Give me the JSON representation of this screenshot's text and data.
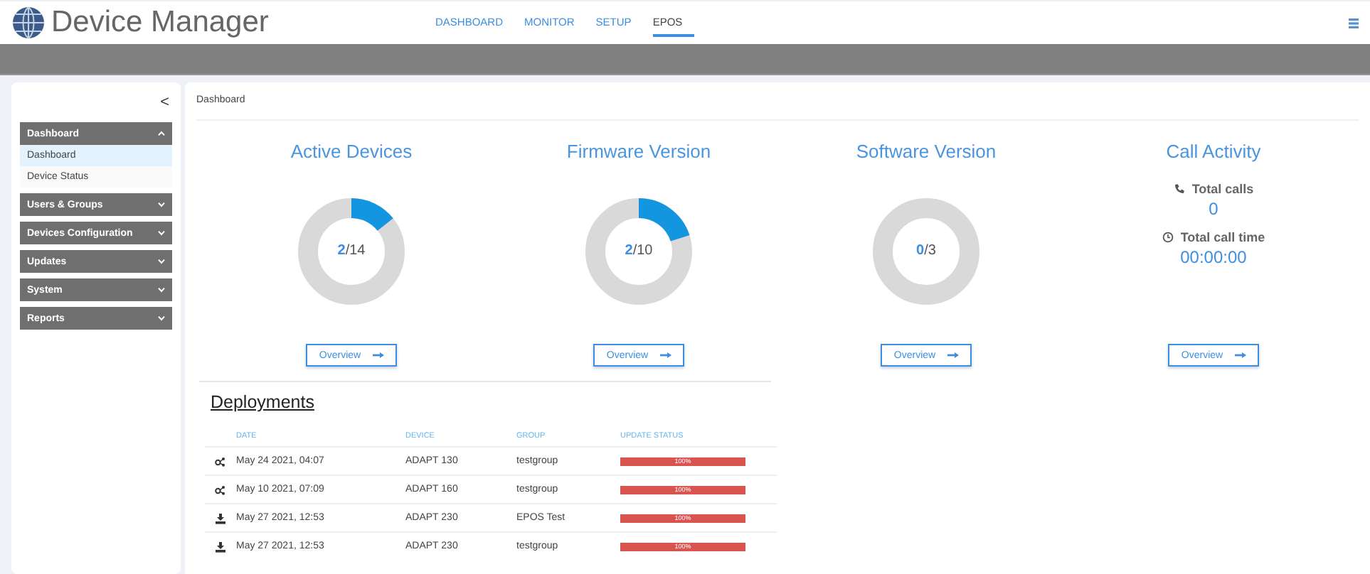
{
  "header": {
    "title": "Device Manager",
    "nav": [
      {
        "label": "DASHBOARD",
        "selected": false
      },
      {
        "label": "MONITOR",
        "selected": false
      },
      {
        "label": "SETUP",
        "selected": false
      },
      {
        "label": "EPOS",
        "selected": true
      }
    ]
  },
  "sidebar": {
    "collapse": "<",
    "sections": [
      {
        "label": "Dashboard",
        "expanded": true,
        "items": [
          {
            "label": "Dashboard",
            "selected": true
          },
          {
            "label": "Device Status",
            "selected": false
          }
        ]
      },
      {
        "label": "Users & Groups",
        "expanded": false
      },
      {
        "label": "Devices Configuration",
        "expanded": false
      },
      {
        "label": "Updates",
        "expanded": false
      },
      {
        "label": "System",
        "expanded": false
      },
      {
        "label": "Reports",
        "expanded": false
      }
    ]
  },
  "breadcrumb": "Dashboard",
  "cards": [
    {
      "kind": "donut",
      "title": "Active Devices",
      "count": "2",
      "total": "/14",
      "button": "Overview"
    },
    {
      "kind": "donut",
      "title": "Firmware Version",
      "count": "2",
      "total": "/10",
      "button": "Overview"
    },
    {
      "kind": "donut",
      "title": "Software Version",
      "count": "0",
      "total": "/3",
      "button": "Overview"
    },
    {
      "kind": "stats",
      "title": "Call Activity",
      "stats": [
        {
          "kind": "calls",
          "label": "Total calls",
          "value": "0"
        },
        {
          "kind": "time",
          "label": "Total call time",
          "value": "00:00:00"
        }
      ],
      "button": "Overview"
    }
  ],
  "deployments": {
    "title": "Deployments",
    "columns": [
      "DATE",
      "DEVICE",
      "GROUP",
      "UPDATE STATUS"
    ],
    "rows": [
      {
        "kind": "share",
        "date": "May 24 2021, 04:07",
        "device": "ADAPT 130",
        "group": "testgroup",
        "level": 1,
        "status": "100%"
      },
      {
        "kind": "share",
        "date": "May 10 2021, 07:09",
        "device": "ADAPT 160",
        "group": "testgroup",
        "level": 1,
        "status": "100%"
      },
      {
        "kind": "download",
        "date": "May 27 2021, 12:53",
        "device": "ADAPT 230",
        "group": "EPOS Test",
        "level": 1,
        "status": "100%"
      },
      {
        "kind": "download",
        "date": "May 27 2021, 12:53",
        "device": "ADAPT 230",
        "group": "testgroup",
        "level": 1,
        "status": "100%"
      }
    ]
  }
}
